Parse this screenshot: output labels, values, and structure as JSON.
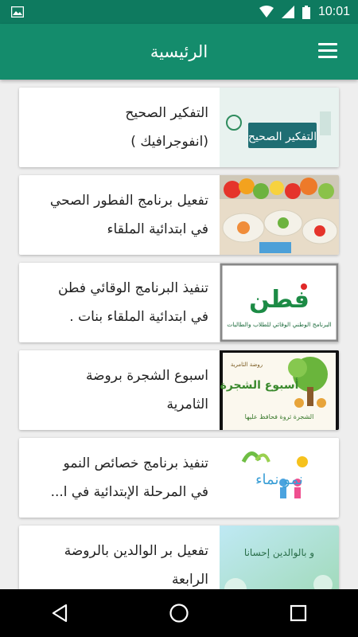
{
  "status_bar": {
    "time": "10:01"
  },
  "app_bar": {
    "title": "الرئيسية"
  },
  "items": [
    {
      "line1": "التفكير الصحيح",
      "line2": "(انفوجرافيك )",
      "thumb_text": "التفكير الصحيح"
    },
    {
      "line1": "تفعيل برنامج الفطور الصحي",
      "line2": "في ابتدائية الملقاء"
    },
    {
      "line1": "تنفيذ البرنامج الوقائي فطن",
      "line2": "في ابتدائية الملقاء بنات .",
      "thumb_title": "فطن",
      "thumb_sub": "البرنامج الوطني الوقائي للطلاب والطالبات"
    },
    {
      "line1": "اسبوع الشجرة بروضة",
      "line2": "الثامرية",
      "thumb_head": "روضة الثامرية",
      "thumb_title": "أسبوع الشجرة",
      "thumb_sub": "الشجرة ثروة فحافظ عليها"
    },
    {
      "line1": "تنفيذ برنامج خصائص النمو",
      "line2": "في المرحلة الإبتدائية في ا...",
      "thumb_title": "نمو نماء"
    },
    {
      "line1": "تفعيل بر الوالدين بالروضة",
      "line2": "الرابعة",
      "thumb_title": "و بالوالدين إحسانا"
    }
  ]
}
